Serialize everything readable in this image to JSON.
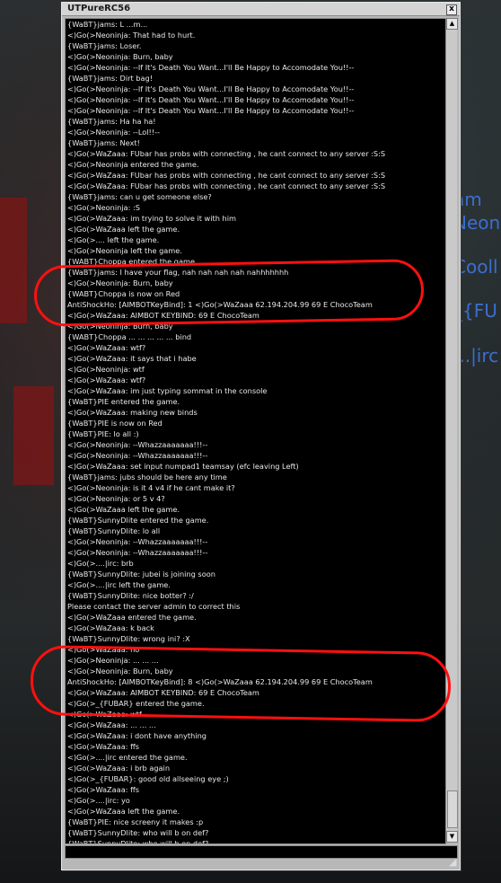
{
  "window": {
    "title": "UTPureRC56",
    "close_glyph": "x"
  },
  "background_text": [
    "am",
    "Neon",
    "Cooll",
    "_{FU",
    "...|irc"
  ],
  "log": [
    "{WaBT}jams: L  ...m...",
    "<)Go(>Neoninja: That had to hurt.",
    "{WaBT}jams: Loser.",
    "<)Go(>Neoninja: Burn, baby",
    "<)Go(>Neoninja: --If It's Death You Want...I'll Be Happy to Accomodate You!!--",
    "{WaBT}jams: Dirt bag!",
    "<)Go(>Neoninja: --If It's Death You Want...I'll Be Happy to Accomodate You!!--",
    "<)Go(>Neoninja: --If It's Death You Want...I'll Be Happy to Accomodate You!!--",
    "<)Go(>Neoninja: --If It's Death You Want...I'll Be Happy to Accomodate You!!--",
    "{WaBT}jams: Ha ha ha!",
    "<)Go(>Neoninja: --Lol!!--",
    "{WaBT}jams: Next!",
    "<)Go(>WaZaaa: FUbar has probs with connecting , he cant connect to any server :S:S",
    "<)Go(>Neoninja entered the game.",
    "<)Go(>WaZaaa: FUbar has probs with connecting , he cant connect to any server :S:S",
    "<)Go(>WaZaaa: FUbar has probs with connecting , he cant connect to any server :S:S",
    "{WaBT}jams: can u get someone else?",
    "<)Go(>Neoninja: :S",
    "<)Go(>WaZaaa: im trying to solve it with him",
    "<)Go(>WaZaaa left the game.",
    "<)Go(>.... left the game.",
    "<)Go(>Neoninja left the game.",
    "{WABT}Choppa entered the game.",
    "{WaBT}jams: I have your flag, nah nah nah nah nahhhhhhh",
    "<)Go(>Neoninja: Burn, baby",
    "{WABT}Choppa is now on Red",
    "AntiShockHo: [AIMBOTKeyBind]: 1 <)Go(>WaZaaa 62.194.204.99 69 E ChocoTeam",
    "<)Go(>WaZaaa: AIMBOT KEYBIND: 69 E ChocoTeam",
    "<)Go(>Neoninja: Burn, baby",
    "{WABT}Choppa ... ... ... ... ... bind",
    "<)Go(>WaZaaa: wtf?",
    "<)Go(>WaZaaa: it says that i habe",
    "<)Go(>Neoninja: wtf",
    "<)Go(>WaZaaa: wtf?",
    "<)Go(>WaZaaa: im just typing sommat in the console",
    "{WaBT}PIE entered the game.",
    "<)Go(>WaZaaa: making new binds",
    "{WaBT}PIE is now on Red",
    "{WaBT}PIE: lo all :)",
    "<)Go(>Neoninja: --Whazzaaaaaaa!!!--",
    "<)Go(>Neoninja: --Whazzaaaaaaa!!!--",
    "<)Go(>WaZaaa: set input numpad1 teamsay  (efc leaving Left)",
    "{WaBT}jams: jubs should be here any time",
    "<)Go(>Neoninja: is it 4 v4 if he cant make it?",
    "<)Go(>Neoninja: or 5 v 4?",
    "<)Go(>WaZaaa left the game.",
    "{WaBT}SunnyDlite entered the game.",
    "{WaBT}SunnyDlite: lo all",
    "<)Go(>Neoninja: --Whazzaaaaaaa!!!--",
    "<)Go(>Neoninja: --Whazzaaaaaaa!!!--",
    "<)Go(>....|irc: brb",
    "{WaBT}SunnyDlite: jubei is joining soon",
    "<)Go(>....|irc left the game.",
    "{WaBT}SunnyDlite: nice botter? :/",
    "Please contact the server admin to correct this",
    "<)Go(>WaZaaa entered the game.",
    "<)Go(>WaZaaa: k back",
    "{WaBT}SunnyDlite: wrong ini? :X",
    "<)Go(>WaZaaa: no",
    "<)Go(>Neoninja: ... ... ...",
    "<)Go(>Neoninja: Burn, baby",
    "AntiShockHo: [AIMBOTKeyBind]: 8 <)Go(>WaZaaa 62.194.204.99 69 E ChocoTeam",
    "<)Go(>WaZaaa: AIMBOT KEYBIND: 69 E ChocoTeam",
    "<)Go(>_{FUBAR} entered the game.",
    "<)Go(>WaZaaa: wtf",
    "<)Go(>WaZaaa: ... ... ...",
    "<)Go(>WaZaaa: i dont have anything",
    "<)Go(>WaZaaa: ffs",
    "<)Go(>....|irc entered the game.",
    "<)Go(>WaZaaa: i brb again",
    "<)Go(>_{FUBAR}: good old allseeing eye ;)",
    "<)Go(>WaZaaa: ffs",
    "<)Go(>....|irc: yo",
    "<)Go(>WaZaaa left the game.",
    "{WaBT}PIE: nice screeny it makes :p",
    "{WaBT}SunnyDlite: who will b on def?",
    "{WaBT}SunnyDlite: who will b on def?"
  ],
  "input": {
    "value": ""
  },
  "icons": {
    "scroll_up": "scroll-up-icon",
    "scroll_down": "scroll-down-icon",
    "resize": "resize-grip-icon"
  },
  "colors": {
    "console_bg": "#000000",
    "text": "#e8e8e8",
    "annotation": "#ff1010",
    "bg_text": "#3a6fd0"
  }
}
